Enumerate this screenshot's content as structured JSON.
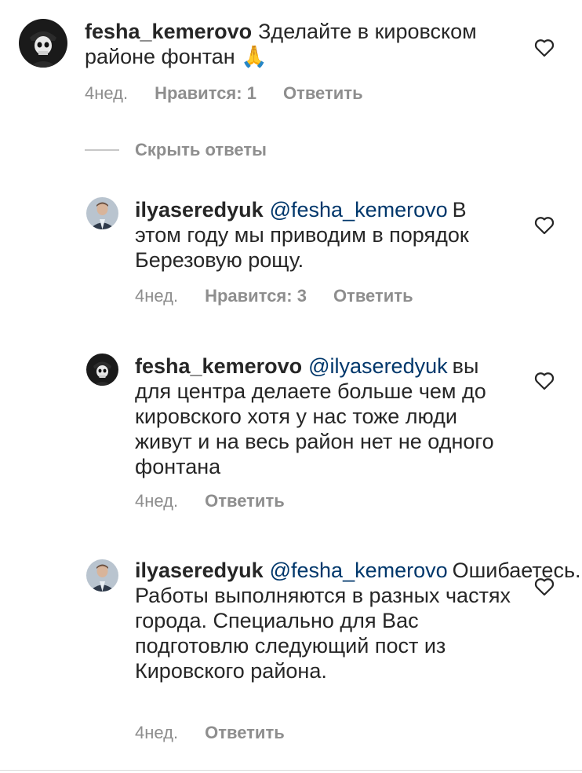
{
  "comments": [
    {
      "username": "fesha_kemerovo",
      "mention": "",
      "text": "Зделайте в кировском районе фонтан 🙏",
      "time": "4нед.",
      "likes": "Нравится: 1",
      "reply": "Ответить"
    },
    {
      "username": "ilyaseredyuk",
      "mention": "@fesha_kemerovo",
      "text": "В этом году мы приводим в порядок Березовую рощу.",
      "time": "4нед.",
      "likes": "Нравится: 3",
      "reply": "Ответить"
    },
    {
      "username": "fesha_kemerovo",
      "mention": "@ilyaseredyuk",
      "text": "вы для центра делаете больше чем до кировского хотя у нас тоже люди живут и на весь район нет не одного фонтана",
      "time": "4нед.",
      "likes": "",
      "reply": "Ответить"
    },
    {
      "username": "ilyaseredyuk",
      "mention": "@fesha_kemerovo",
      "text": "Ошибаетесь. Работы выполняются в разных частях города. Специально для Вас подготовлю следующий пост из Кировского района.",
      "time": "4нед.",
      "likes": "",
      "reply": "Ответить"
    }
  ],
  "hide_replies_label": "Скрыть ответы",
  "icons": {
    "like": "heart-outline-icon",
    "avatar_fesha": "skull-avatar-icon",
    "avatar_ilya": "person-avatar-icon"
  },
  "colors": {
    "text": "#262626",
    "muted": "#8e8e8e",
    "mention": "#00376b"
  }
}
